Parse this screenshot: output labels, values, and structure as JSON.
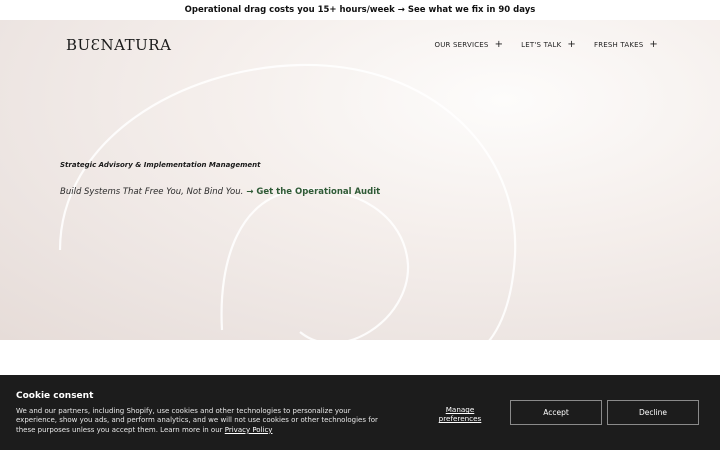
{
  "announcement": {
    "text": "Operational drag costs you 15+ hours/week → See what we fix in 90 days"
  },
  "header": {
    "logo": "BUƐNATURA",
    "nav": [
      {
        "label": "OUR SERVICES",
        "icon": "plus-icon"
      },
      {
        "label": "LET'S TALK",
        "icon": "plus-icon"
      },
      {
        "label": "FRESH TAKES",
        "icon": "plus-icon"
      }
    ]
  },
  "hero": {
    "eyebrow": "Strategic Advisory & Implementation Management",
    "tagline": "Build Systems That Free You, Not Bind You.",
    "cta": "→ Get the Operational Audit"
  },
  "cookie": {
    "title": "Cookie consent",
    "body": "We and our partners, including Shopify, use cookies and other technologies to personalize your experience, show you ads, and perform analytics, and we will not use cookies or other technologies for these purposes unless you accept them. Learn more in our ",
    "privacy_link": "Privacy Policy",
    "manage": "Manage preferences",
    "accept": "Accept",
    "decline": "Decline"
  },
  "colors": {
    "cta": "#2f5a36",
    "banner_bg": "#1c1c1c",
    "hero_bg": "#ece4e1"
  }
}
